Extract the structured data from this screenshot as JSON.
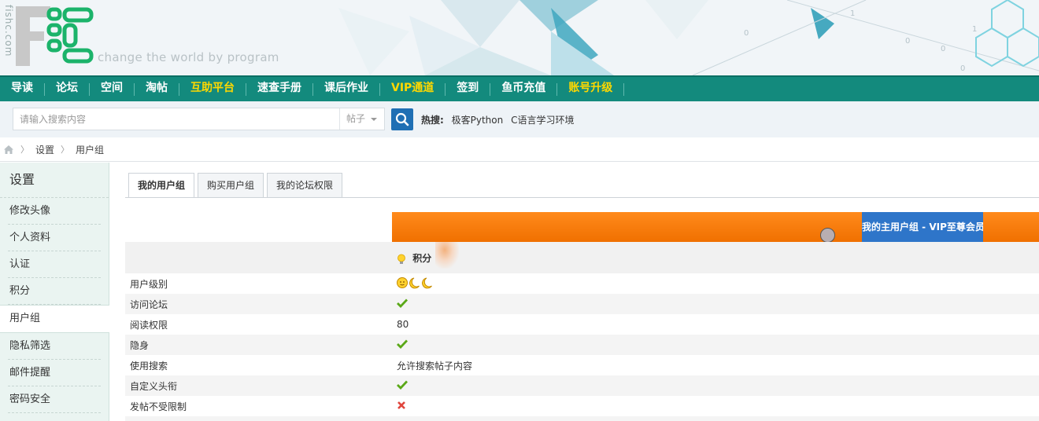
{
  "header": {
    "side_text": "fishc.com",
    "slogan": "change the world by program",
    "logo_text": "FC"
  },
  "nav": {
    "items": [
      {
        "label": "导读",
        "highlight": false
      },
      {
        "label": "论坛",
        "highlight": false
      },
      {
        "label": "空间",
        "highlight": false
      },
      {
        "label": "淘帖",
        "highlight": false
      },
      {
        "label": "互助平台",
        "highlight": true
      },
      {
        "label": "速查手册",
        "highlight": false
      },
      {
        "label": "课后作业",
        "highlight": false
      },
      {
        "label": "VIP通道",
        "highlight": true
      },
      {
        "label": "签到",
        "highlight": false
      },
      {
        "label": "鱼币充值",
        "highlight": false
      },
      {
        "label": "账号升级",
        "highlight": true
      }
    ]
  },
  "search": {
    "placeholder": "请输入搜索内容",
    "type": "帖子",
    "hot_label": "热搜:",
    "hot_items": [
      "极客Python",
      "C语言学习环境"
    ]
  },
  "breadcrumb": {
    "items": [
      "设置",
      "用户组"
    ]
  },
  "sidebar": {
    "title": "设置",
    "items": [
      {
        "label": "修改头像",
        "active": false
      },
      {
        "label": "个人资料",
        "active": false
      },
      {
        "label": "认证",
        "active": false
      },
      {
        "label": "积分",
        "active": false
      },
      {
        "label": "用户组",
        "active": true
      },
      {
        "label": "隐私筛选",
        "active": false
      },
      {
        "label": "邮件提醒",
        "active": false
      },
      {
        "label": "密码安全",
        "active": false
      }
    ]
  },
  "tabs": [
    {
      "label": "我的用户组",
      "active": true
    },
    {
      "label": "购买用户组",
      "active": false
    },
    {
      "label": "我的论坛权限",
      "active": false
    }
  ],
  "group": {
    "main_group": "我的主用户组 - VIP至尊会员",
    "score_label": "积分"
  },
  "rows": [
    {
      "label": "用户级别",
      "kind": "level",
      "value": ""
    },
    {
      "label": "访问论坛",
      "kind": "check",
      "value": ""
    },
    {
      "label": "阅读权限",
      "kind": "text",
      "value": "80"
    },
    {
      "label": "隐身",
      "kind": "check",
      "value": ""
    },
    {
      "label": "使用搜索",
      "kind": "text",
      "value": "允许搜索帖子内容"
    },
    {
      "label": "自定义头衔",
      "kind": "check",
      "value": ""
    },
    {
      "label": "发帖不受限制",
      "kind": "cross",
      "value": ""
    }
  ],
  "colors": {
    "nav_bg": "#138a7d",
    "nav_highlight": "#ffd800",
    "search_button": "#1f6fb4",
    "vip_cell": "#2e75c9",
    "orange_bar": "#f07000",
    "check": "#5aa817",
    "cross": "#e0463d"
  }
}
